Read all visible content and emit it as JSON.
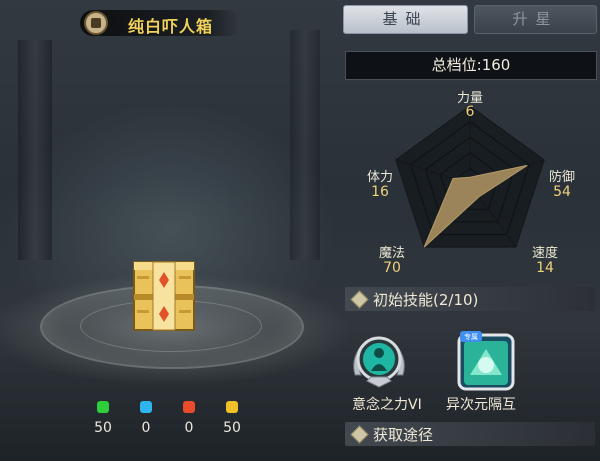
{
  "character": {
    "name": "纯白吓人箱"
  },
  "elements": [
    {
      "color": "#2fcf3b",
      "value": "50"
    },
    {
      "color": "#2fb5ee",
      "value": "0"
    },
    {
      "color": "#ea4b2a",
      "value": "0"
    },
    {
      "color": "#f1c12a",
      "value": "50"
    }
  ],
  "tabs": {
    "basic": "基础",
    "star": "升星"
  },
  "total": "总档位:160",
  "stats": {
    "strength": {
      "label": "力量",
      "value": "6"
    },
    "defense": {
      "label": "防御",
      "value": "54"
    },
    "speed": {
      "label": "速度",
      "value": "14"
    },
    "magic": {
      "label": "魔法",
      "value": "70"
    },
    "stamina": {
      "label": "体力",
      "value": "16"
    }
  },
  "stat_max": 70,
  "skills_header": "初始技能(2/10)",
  "skills": [
    {
      "name": "意念之力VI",
      "icon": "mind-power-icon"
    },
    {
      "name": "异次元隔互",
      "icon": "dimension-barrier-icon",
      "badge": "专属"
    }
  ],
  "obtain_header": "获取途径",
  "colors": {
    "radar_fill": "#9c845a",
    "stat_value": "#f1d27a",
    "name": "#f2d25a"
  }
}
